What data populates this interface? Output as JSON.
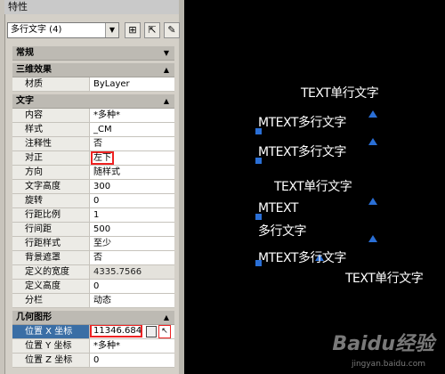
{
  "palette": {
    "title": "特性",
    "selection": "多行文字 (4)"
  },
  "sections": {
    "general": "常规",
    "3d": "三维效果",
    "text": "文字",
    "geometry": "几何图形"
  },
  "rows_3d": [
    {
      "k": "材质",
      "v": "ByLayer"
    }
  ],
  "rows_text": [
    {
      "k": "内容",
      "v": "*多种*"
    },
    {
      "k": "样式",
      "v": "_CM"
    },
    {
      "k": "注释性",
      "v": "否"
    },
    {
      "k": "对正",
      "v": "左下"
    },
    {
      "k": "方向",
      "v": "随样式"
    },
    {
      "k": "文字高度",
      "v": "300"
    },
    {
      "k": "旋转",
      "v": "0"
    },
    {
      "k": "行距比例",
      "v": "1"
    },
    {
      "k": "行间距",
      "v": "500"
    },
    {
      "k": "行距样式",
      "v": "至少"
    },
    {
      "k": "背景遮罩",
      "v": "否"
    },
    {
      "k": "定义的宽度",
      "v": "4335.7566"
    },
    {
      "k": "定义高度",
      "v": "0"
    },
    {
      "k": "分栏",
      "v": "动态"
    }
  ],
  "rows_geo": [
    {
      "k": "位置 X 坐标",
      "v": "11346.684"
    },
    {
      "k": "位置 Y 坐标",
      "v": "*多种*"
    },
    {
      "k": "位置 Z 坐标",
      "v": "0"
    }
  ],
  "canvas_texts": [
    "TEXT单行文字",
    "MTEXT多行文字",
    "MTEXT多行文字",
    "TEXT单行文字",
    "MTEXT",
    "多行文字",
    "MTEXT多行文字",
    "TEXT单行文字"
  ],
  "watermark": {
    "brand": "Baidu经验",
    "url": "jingyan.baidu.com"
  },
  "colors": {
    "grip": "#2a6fd6",
    "highlight": "#e22222",
    "selected_row": "#3a6ea5"
  }
}
